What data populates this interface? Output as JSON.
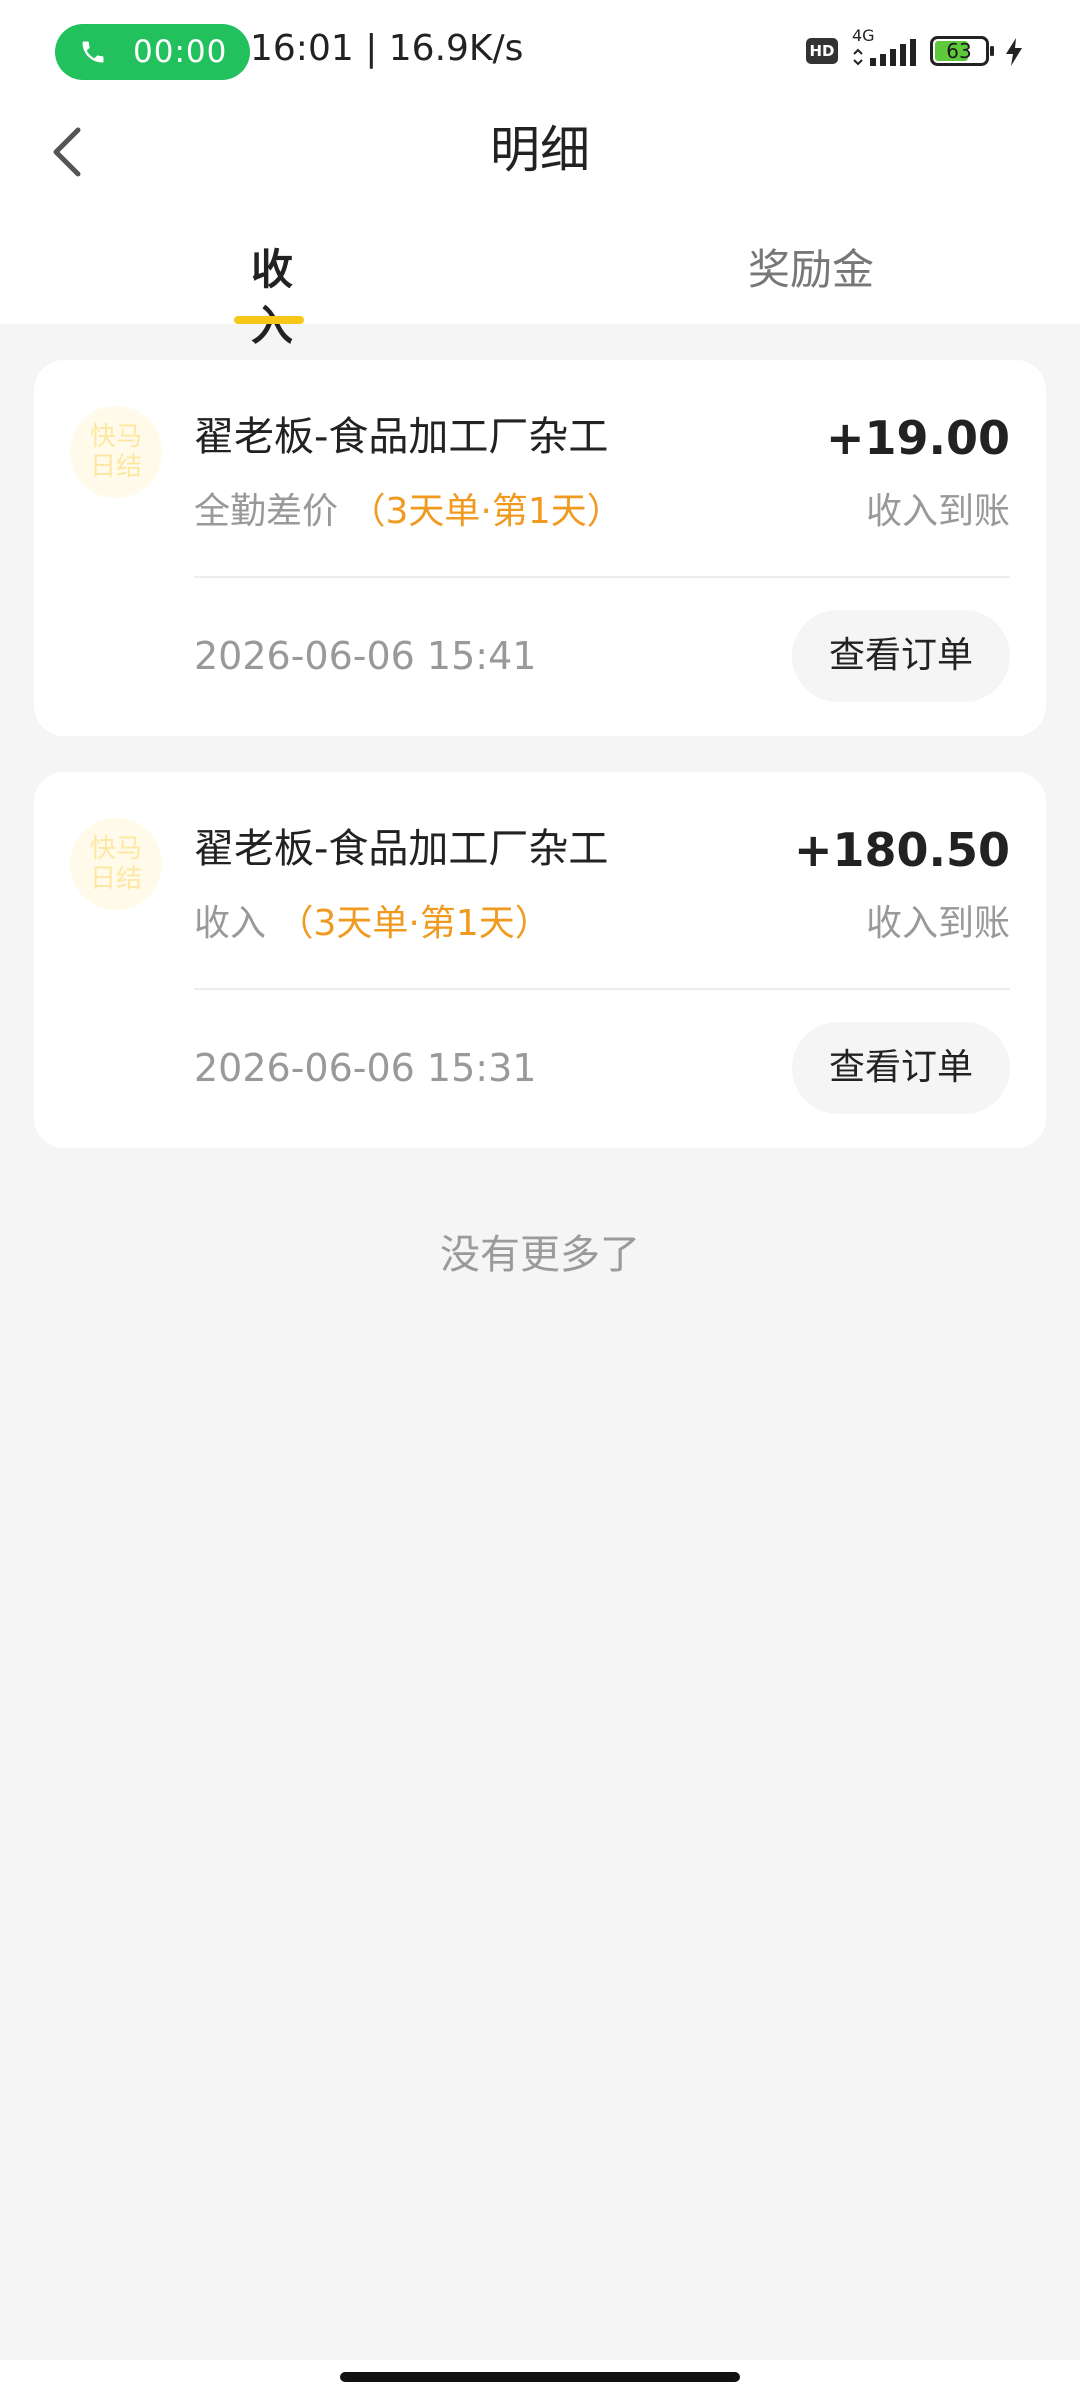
{
  "status_bar": {
    "call_time": "00:00",
    "time_speed": "16:01 | 16.9K/s",
    "hd_label": "HD",
    "network_type": "4G",
    "battery_level": "63",
    "call_color": "#22c15e"
  },
  "header": {
    "title": "明细",
    "back_icon": "chevron-left-icon"
  },
  "tabs": [
    {
      "label": "收入",
      "active": true
    },
    {
      "label": "奖励金",
      "active": false
    }
  ],
  "accent_color": "#f7c81a",
  "highlight_color": "#f09a1f",
  "records": [
    {
      "logo_line1": "快马",
      "logo_line2": "日结",
      "title": "翟老板-食品加工厂杂工",
      "amount": "+19.00",
      "type": "全勤差价",
      "detail": "（3天单·第1天）",
      "status": "收入到账",
      "time": "2026-06-06 15:41",
      "action": "查看订单"
    },
    {
      "logo_line1": "快马",
      "logo_line2": "日结",
      "title": "翟老板-食品加工厂杂工",
      "amount": "+180.50",
      "type": "收入",
      "detail": "（3天单·第1天）",
      "status": "收入到账",
      "time": "2026-06-06 15:31",
      "action": "查看订单"
    }
  ],
  "footer": {
    "no_more": "没有更多了"
  }
}
